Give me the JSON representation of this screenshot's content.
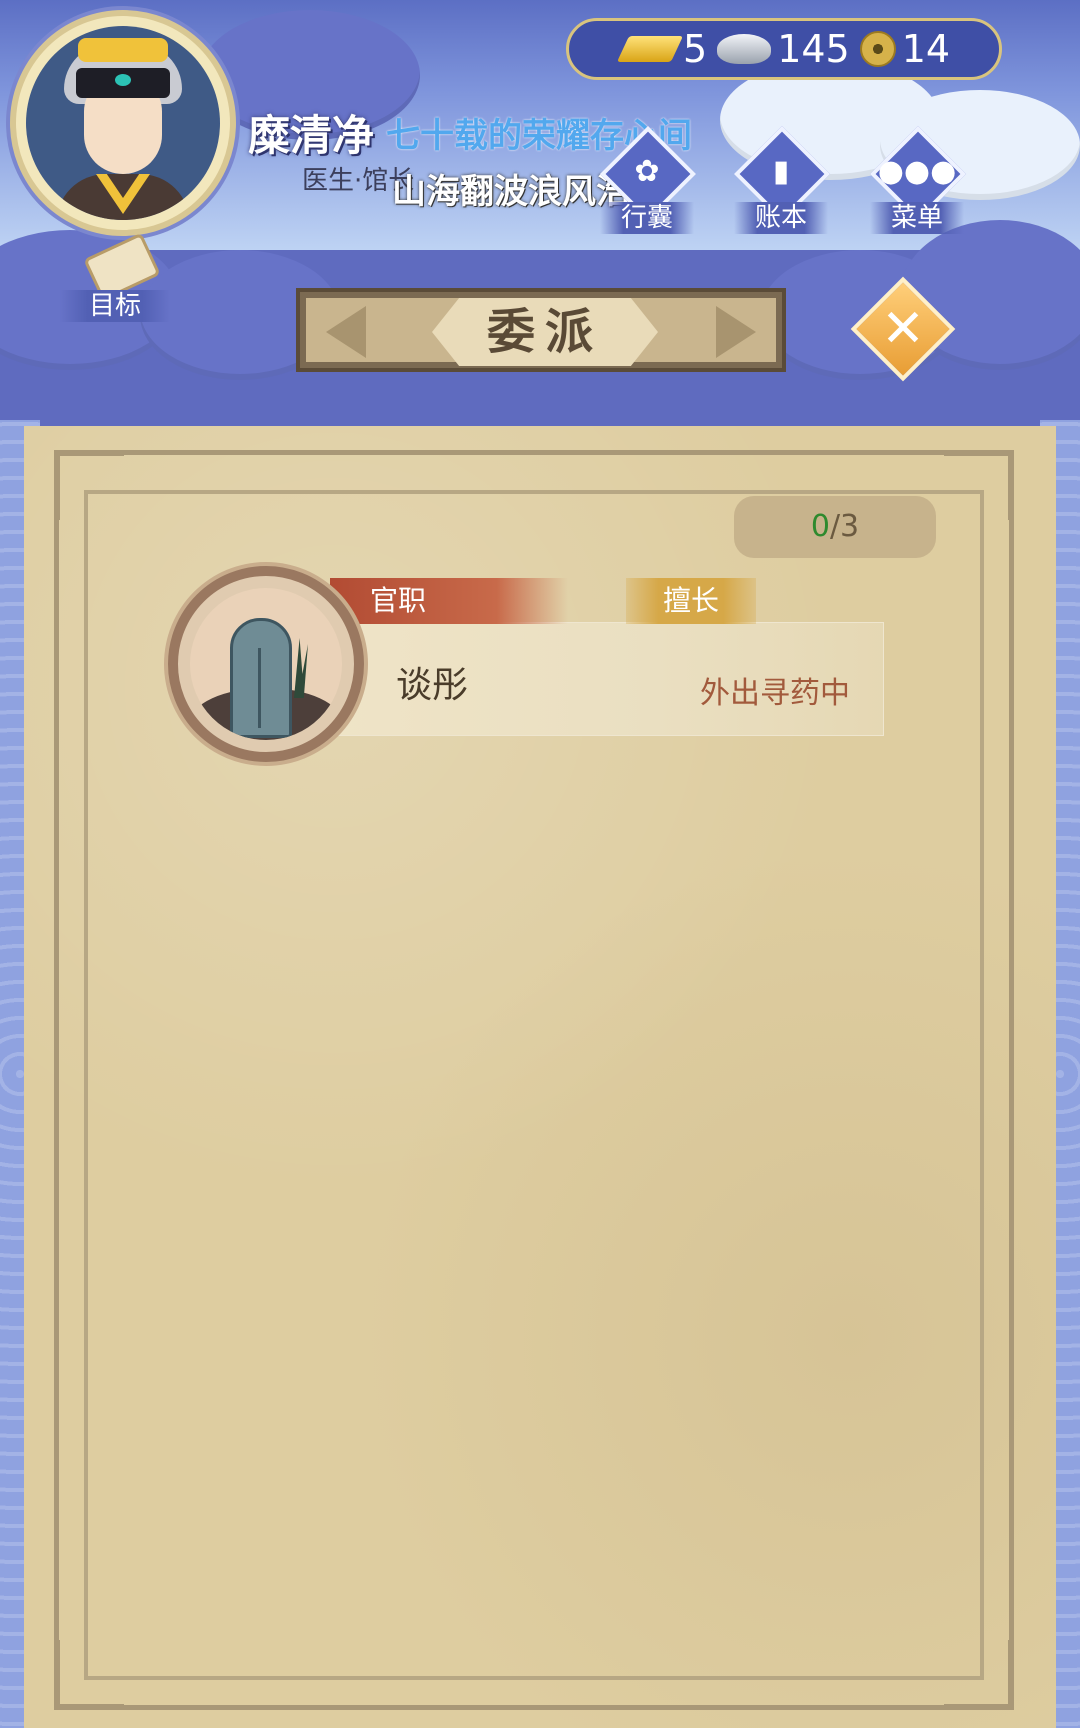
{
  "player": {
    "name": "糜清净",
    "title": "医生·馆长"
  },
  "overlay_text": {
    "line1": "七十载的荣耀存心间",
    "line2": "山海翻波浪风浩荡"
  },
  "currency": {
    "gold": "5",
    "silver": "145",
    "coins": "14"
  },
  "menu": {
    "bag_label": "行囊",
    "ledger_label": "账本",
    "menu_label": "菜单",
    "goal_label": "目标"
  },
  "panel": {
    "title": "委派",
    "counter_current": "0",
    "counter_total": "/3"
  },
  "officials": [
    {
      "tag_position": "官职",
      "tag_skill": "擅长",
      "name": "谈彤",
      "status": "外出寻药中"
    }
  ],
  "colors": {
    "parchment": "#decda0",
    "accent_blue": "#5260b4",
    "status_red": "#a25a3c",
    "counter_green": "#2e8a2e"
  },
  "icons": {
    "gold": "gold-ingot-icon",
    "silver": "silver-ingot-icon",
    "coin": "copper-coin-icon",
    "bag": "bag-icon",
    "ledger": "ledger-icon",
    "menu": "more-dots-icon",
    "goal": "scroll-icon",
    "close": "close-icon"
  }
}
